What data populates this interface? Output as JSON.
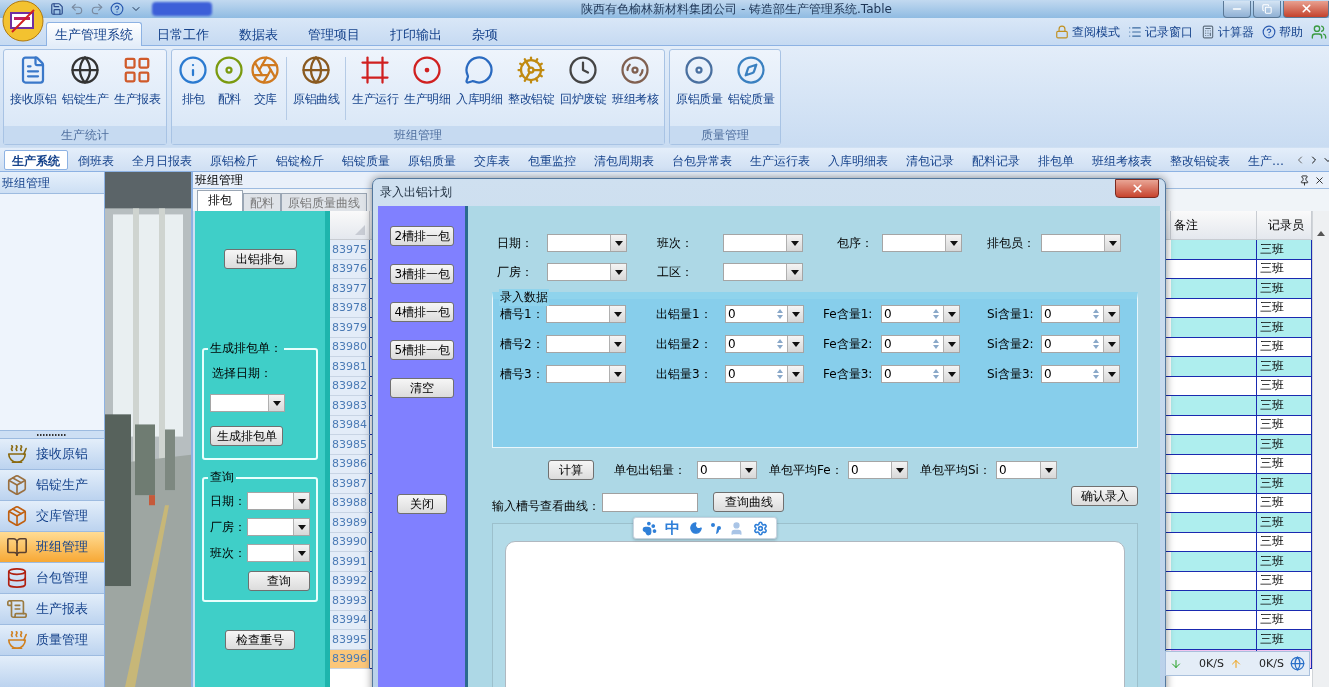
{
  "title_bar": {
    "title": "陕西有色榆林新材料集团公司 - 铸造部生产管理系统.Table"
  },
  "ribbon": {
    "tabs": [
      {
        "label": "生产管理系统",
        "selected": true
      },
      {
        "label": "日常工作",
        "selected": false
      },
      {
        "label": "数据表",
        "selected": false
      },
      {
        "label": "管理项目",
        "selected": false
      },
      {
        "label": "打印输出",
        "selected": false
      },
      {
        "label": "杂项",
        "selected": false
      }
    ],
    "quick_links": [
      "查阅模式",
      "记录窗口",
      "计算器",
      "帮助"
    ],
    "groups": [
      {
        "title": "生产统计",
        "sections": [
          [
            "接收原铝",
            "铝锭生产",
            "生产报表"
          ]
        ]
      },
      {
        "title": "班组管理",
        "sections": [
          [
            "排包",
            "配料",
            "交库"
          ],
          [
            "原铝曲线"
          ],
          [
            "生产运行",
            "生产明细",
            "入库明细",
            "整改铝锭",
            "回炉废锭",
            "班组考核"
          ]
        ]
      },
      {
        "title": "质量管理",
        "sections": [
          [
            "原铝质量",
            "铝锭质量"
          ]
        ]
      }
    ]
  },
  "doc_tabs": [
    {
      "label": "生产系统",
      "selected": true
    },
    {
      "label": "倒班表",
      "selected": false
    },
    {
      "label": "全月日报表",
      "selected": false
    },
    {
      "label": "原铝检斤",
      "selected": false
    },
    {
      "label": "铝锭检斤",
      "selected": false
    },
    {
      "label": "铝锭质量",
      "selected": false
    },
    {
      "label": "原铝质量",
      "selected": false
    },
    {
      "label": "交库表",
      "selected": false
    },
    {
      "label": "包重监控",
      "selected": false
    },
    {
      "label": "清包周期表",
      "selected": false
    },
    {
      "label": "台包异常表",
      "selected": false
    },
    {
      "label": "生产运行表",
      "selected": false
    },
    {
      "label": "入库明细表",
      "selected": false
    },
    {
      "label": "清包记录",
      "selected": false
    },
    {
      "label": "配料记录",
      "selected": false
    },
    {
      "label": "排包单",
      "selected": false
    },
    {
      "label": "班组考核表",
      "selected": false
    },
    {
      "label": "整改铝锭表",
      "selected": false
    },
    {
      "label": "生产…",
      "selected": false
    }
  ],
  "nav": {
    "title": "班组管理",
    "items": [
      {
        "label": "接收原铝",
        "selected": false
      },
      {
        "label": "铝锭生产",
        "selected": false
      },
      {
        "label": "交库管理",
        "selected": false
      },
      {
        "label": "班组管理",
        "selected": true
      },
      {
        "label": "台包管理",
        "selected": false
      },
      {
        "label": "生产报表",
        "selected": false
      },
      {
        "label": "质量管理",
        "selected": false
      }
    ]
  },
  "panel": {
    "title": "班组管理",
    "tabs": [
      {
        "label": "排包",
        "selected": true
      },
      {
        "label": "配料",
        "selected": false
      },
      {
        "label": "原铝质量曲线",
        "selected": false
      }
    ],
    "side": {
      "arrange_button": "出铝排包",
      "generate_group": {
        "title": "生成排包单：",
        "date_label": "选择日期：",
        "button": "生成排包单"
      },
      "query_group": {
        "title": "查询",
        "fields": [
          "日期：",
          "厂房：",
          "班次："
        ],
        "button": "查询"
      },
      "check_button": "检查重号"
    },
    "grid": {
      "columns": [
        "备注",
        "记录员"
      ],
      "rows": [
        {
          "number": "83975",
          "recorder": "三班",
          "selected": false
        },
        {
          "number": "83976",
          "recorder": "三班",
          "selected": false
        },
        {
          "number": "83977",
          "recorder": "三班",
          "selected": false
        },
        {
          "number": "83978",
          "recorder": "三班",
          "selected": false
        },
        {
          "number": "83979",
          "recorder": "三班",
          "selected": false
        },
        {
          "number": "83980",
          "recorder": "三班",
          "selected": false
        },
        {
          "number": "83981",
          "recorder": "三班",
          "selected": false
        },
        {
          "number": "83982",
          "recorder": "三班",
          "selected": false
        },
        {
          "number": "83983",
          "recorder": "三班",
          "selected": false
        },
        {
          "number": "83984",
          "recorder": "三班",
          "selected": false
        },
        {
          "number": "83985",
          "recorder": "三班",
          "selected": false
        },
        {
          "number": "83986",
          "recorder": "三班",
          "selected": false
        },
        {
          "number": "83987",
          "recorder": "三班",
          "selected": false
        },
        {
          "number": "83988",
          "recorder": "三班",
          "selected": false
        },
        {
          "number": "83989",
          "recorder": "三班",
          "selected": false
        },
        {
          "number": "83990",
          "recorder": "三班",
          "selected": false
        },
        {
          "number": "83991",
          "recorder": "三班",
          "selected": false
        },
        {
          "number": "83992",
          "recorder": "三班",
          "selected": false
        },
        {
          "number": "83993",
          "recorder": "三班",
          "selected": false
        },
        {
          "number": "83994",
          "recorder": "三班",
          "selected": false
        },
        {
          "number": "83995",
          "recorder": "三班",
          "selected": false
        },
        {
          "number": "83996",
          "selected": true
        }
      ]
    }
  },
  "dialog": {
    "title": "录入出铝计划",
    "side_buttons": [
      "2槽排一包",
      "3槽排一包",
      "4槽排一包",
      "5槽排一包",
      "清空"
    ],
    "close_button": "关闭",
    "header_rows": [
      [
        "日期：",
        "班次：",
        "包序：",
        "排包员："
      ],
      [
        "厂房：",
        "工区："
      ]
    ],
    "data_group": {
      "title": "录入数据",
      "rows": [
        [
          {
            "kind": "combo",
            "label": "槽号1："
          },
          {
            "kind": "spin",
            "label": "出铝量1：",
            "value": "0"
          },
          {
            "kind": "spin",
            "label": "Fe含量1:",
            "value": "0"
          },
          {
            "kind": "spin",
            "label": "Si含量1:",
            "value": "0"
          }
        ],
        [
          {
            "kind": "combo",
            "label": "槽号2："
          },
          {
            "kind": "spin",
            "label": "出铝量2：",
            "value": "0"
          },
          {
            "kind": "spin",
            "label": "Fe含量2:",
            "value": "0"
          },
          {
            "kind": "spin",
            "label": "Si含量2:",
            "value": "0"
          }
        ],
        [
          {
            "kind": "combo",
            "label": "槽号3："
          },
          {
            "kind": "spin",
            "label": "出铝量3：",
            "value": "0"
          },
          {
            "kind": "spin",
            "label": "Fe含量3:",
            "value": "0"
          },
          {
            "kind": "spin",
            "label": "Si含量3:",
            "value": "0"
          }
        ]
      ]
    },
    "calc_button": "计算",
    "summary": [
      {
        "label": "单包出铝量：",
        "value": "0"
      },
      {
        "label": "单包平均Fe：",
        "value": "0"
      },
      {
        "label": "单包平均Si：",
        "value": "0"
      }
    ],
    "confirm_button": "确认录入",
    "curve_label": "输入槽号查看曲线：",
    "curve_button": "查询曲线"
  },
  "ime_toolbar": {
    "mode": "中"
  },
  "net_speed": {
    "down": "0K/S",
    "up": "0K/S"
  }
}
